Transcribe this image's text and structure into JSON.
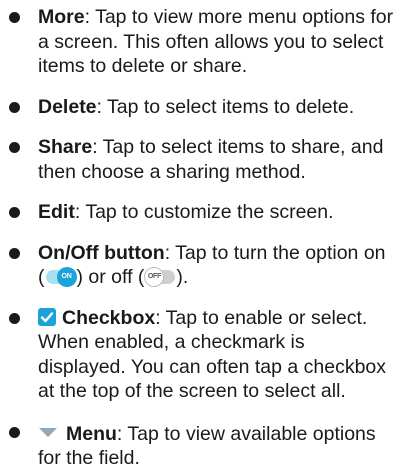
{
  "items": [
    {
      "term": "More",
      "text": ": Tap to view more menu options for a screen. This often allows you to select items to delete or share."
    },
    {
      "term": "Delete",
      "text": ": Tap to select items to delete."
    },
    {
      "term": "Share",
      "text": ": Tap to select items to share, and then choose a sharing method."
    },
    {
      "term": "Edit",
      "text": ": Tap to customize the screen."
    },
    {
      "term": "On/Off button",
      "text_a": ": Tap to turn the option on (",
      "text_b": ") or off (",
      "text_c": ").",
      "on_label": "ON",
      "off_label": "OFF"
    },
    {
      "icon": "checkbox-checked-icon",
      "term": "Checkbox",
      "text": ": Tap to enable or select. When enabled, a checkmark is displayed. You can often tap a checkbox at the top of the screen to select all."
    },
    {
      "icon": "dropdown-triangle-icon",
      "term": "Menu",
      "text": ": Tap to view available options for the field."
    }
  ],
  "colors": {
    "accent": "#1aa3d9",
    "toggle_track_on": "#a9e0ef",
    "toggle_track_off": "#cfcfcf",
    "menu_triangle": "#8fa9b8",
    "text": "#1a1a1a"
  }
}
